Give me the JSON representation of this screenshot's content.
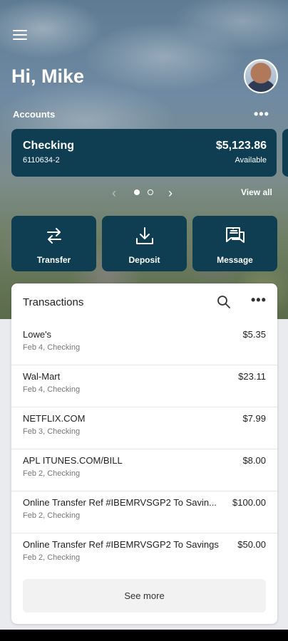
{
  "header": {
    "greeting": "Hi, Mike",
    "menu_icon": "hamburger-menu-icon",
    "avatar_icon": "user-avatar"
  },
  "accounts": {
    "label": "Accounts",
    "more_icon": "more-horizontal-icon",
    "cards": [
      {
        "name": "Checking",
        "number": "6110634-2",
        "balance": "$5,123.86",
        "balance_label": "Available"
      }
    ],
    "pager": {
      "current": 1,
      "total": 2
    },
    "view_all": "View all"
  },
  "actions": [
    {
      "label": "Transfer",
      "icon": "transfer-arrows-icon"
    },
    {
      "label": "Deposit",
      "icon": "deposit-download-icon"
    },
    {
      "label": "Message",
      "icon": "message-chat-icon"
    }
  ],
  "transactions": {
    "title": "Transactions",
    "search_icon": "search-icon",
    "more_icon": "more-horizontal-icon",
    "items": [
      {
        "desc": "Lowe's",
        "meta": "Feb 4, Checking",
        "amount": "$5.35"
      },
      {
        "desc": "Wal-Mart",
        "meta": "Feb 4, Checking",
        "amount": "$23.11"
      },
      {
        "desc": "NETFLIX.COM",
        "meta": "Feb 3, Checking",
        "amount": "$7.99"
      },
      {
        "desc": "APL ITUNES.COM/BILL",
        "meta": "Feb 2, Checking",
        "amount": "$8.00"
      },
      {
        "desc": "Online Transfer Ref #IBEMRVSGP2 To Savin...",
        "meta": "Feb 2, Checking",
        "amount": "$100.00"
      },
      {
        "desc": "Online Transfer Ref #IBEMRVSGP2 To Savings",
        "meta": "Feb 2, Checking",
        "amount": "$50.00"
      }
    ],
    "see_more": "See more"
  },
  "colors": {
    "brand_dark": "#0f3d52",
    "card_bg": "#ffffff"
  }
}
